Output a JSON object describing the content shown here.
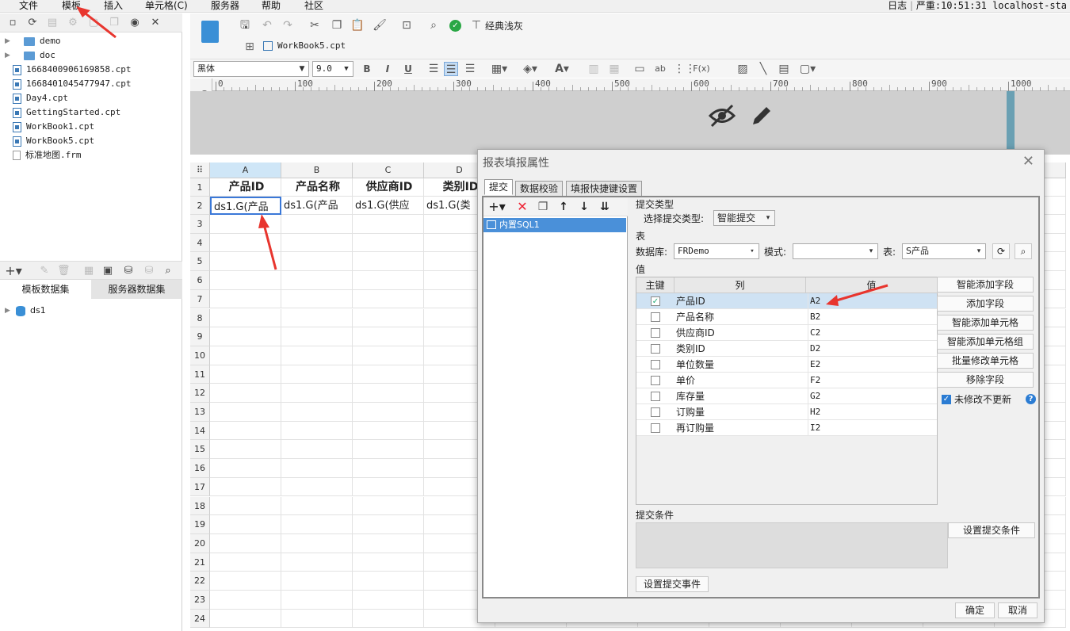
{
  "menu": [
    "文件",
    "模板",
    "插入",
    "单元格(C)",
    "服务器",
    "帮助",
    "社区"
  ],
  "status": {
    "log": "日志",
    "level": "严重:10:51:31 localhost-sta"
  },
  "tree": [
    {
      "name": "demo",
      "type": "folder"
    },
    {
      "name": "doc",
      "type": "folder"
    },
    {
      "name": "1668400906169858.cpt",
      "type": "cpt"
    },
    {
      "name": "1668401045477947.cpt",
      "type": "cpt"
    },
    {
      "name": "Day4.cpt",
      "type": "cpt"
    },
    {
      "name": "GettingStarted.cpt",
      "type": "cpt"
    },
    {
      "name": "WorkBook1.cpt",
      "type": "cpt"
    },
    {
      "name": "WorkBook5.cpt",
      "type": "cpt"
    },
    {
      "name": "标准地图.frm",
      "type": "frm"
    }
  ],
  "ds_tabs": [
    "模板数据集",
    "服务器数据集"
  ],
  "ds_items": [
    "ds1"
  ],
  "toolbar": {
    "style_label": "经典浅灰",
    "file_tab": "WorkBook5.cpt",
    "font": "黑体",
    "font_size": "9.0",
    "bold": "B",
    "italic": "I",
    "underline": "U",
    "ab": "ab",
    "fx": "F(x)"
  },
  "ruler": [
    "0",
    "100",
    "200",
    "300",
    "400",
    "500",
    "600",
    "700",
    "800",
    "900",
    "1000"
  ],
  "ruler_v": "0",
  "sheet": {
    "columns": [
      "A",
      "B",
      "C",
      "D"
    ],
    "rows": [
      "1",
      "2",
      "3",
      "4",
      "5",
      "6",
      "7",
      "8",
      "9",
      "10",
      "11",
      "12",
      "13",
      "14",
      "15",
      "16",
      "17",
      "18",
      "19",
      "20",
      "21",
      "22",
      "23",
      "24"
    ],
    "header_row": [
      "产品ID",
      "产品名称",
      "供应商ID",
      "类别ID"
    ],
    "data_row": [
      "ds1.G(产品",
      "ds1.G(产品",
      "ds1.G(供应",
      "ds1.G(类"
    ]
  },
  "dialog": {
    "title": "报表填报属性",
    "tabs": [
      "提交",
      "数据校验",
      "填报快捷键设置"
    ],
    "list_item": "内置SQL1",
    "submit_type_section": "提交类型",
    "submit_type_label": "选择提交类型:",
    "submit_type_value": "智能提交",
    "table_section": "表",
    "db_label": "数据库:",
    "db_value": "FRDemo",
    "mode_label": "模式:",
    "mode_value": "",
    "table_label": "表:",
    "table_value": "S产品",
    "value_section": "值",
    "grid_headers": [
      "主键",
      "列",
      "值"
    ],
    "grid_rows": [
      {
        "key": true,
        "col": "产品ID",
        "val": "A2"
      },
      {
        "key": false,
        "col": "产品名称",
        "val": "B2"
      },
      {
        "key": false,
        "col": "供应商ID",
        "val": "C2"
      },
      {
        "key": false,
        "col": "类别ID",
        "val": "D2"
      },
      {
        "key": false,
        "col": "单位数量",
        "val": "E2"
      },
      {
        "key": false,
        "col": "单价",
        "val": "F2"
      },
      {
        "key": false,
        "col": "库存量",
        "val": "G2"
      },
      {
        "key": false,
        "col": "订购量",
        "val": "H2"
      },
      {
        "key": false,
        "col": "再订购量",
        "val": "I2"
      }
    ],
    "side_buttons": [
      "智能添加字段",
      "添加字段",
      "智能添加单元格",
      "智能添加单元格组",
      "批量修改单元格",
      "移除字段"
    ],
    "no_update_label": "未修改不更新",
    "condition_section": "提交条件",
    "set_condition": "设置提交条件",
    "set_event": "设置提交事件",
    "ok": "确定",
    "cancel": "取消"
  },
  "colors": {
    "accent": "#4a90d9",
    "arrow": "#e8352e",
    "selected": "#cfe2f3"
  }
}
